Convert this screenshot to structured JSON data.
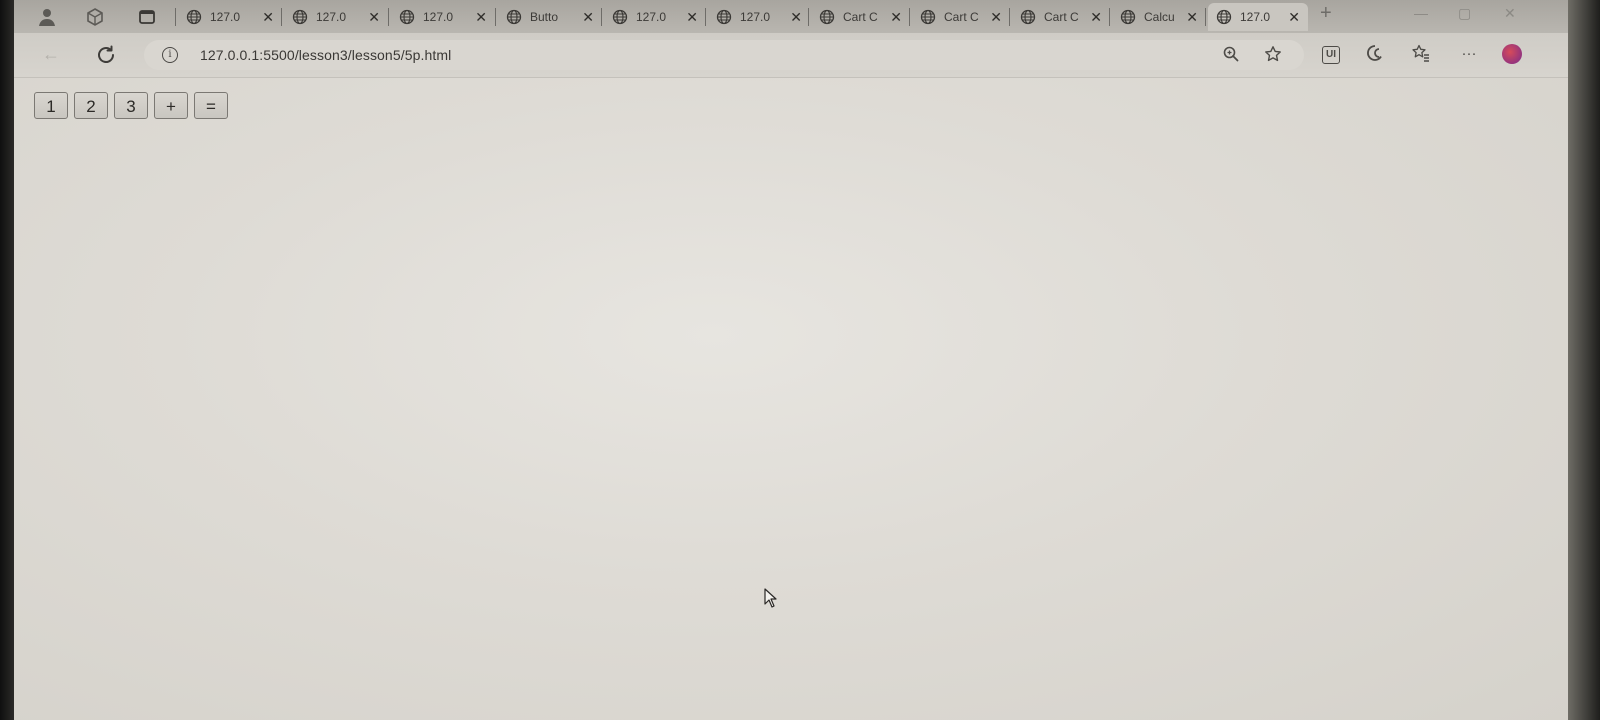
{
  "tabs": [
    {
      "title": "127.0",
      "active": false
    },
    {
      "title": "127.0",
      "active": false
    },
    {
      "title": "127.0",
      "active": false
    },
    {
      "title": "Butto",
      "active": false
    },
    {
      "title": "127.0",
      "active": false
    },
    {
      "title": "127.0",
      "active": false
    },
    {
      "title": "Cart C",
      "active": false
    },
    {
      "title": "Cart C",
      "active": false
    },
    {
      "title": "Cart C",
      "active": false
    },
    {
      "title": "Calcu",
      "active": false
    },
    {
      "title": "127.0",
      "active": true
    }
  ],
  "tab_close_glyph": "✕",
  "toolbar": {
    "url": "127.0.0.1:5500/lesson3/lesson5/5p.html",
    "ui_badge": "UI"
  },
  "calculator": {
    "buttons": [
      "1",
      "2",
      "3",
      "+",
      "="
    ]
  },
  "icons": {
    "tab": "globe-icon",
    "reload": "reload-icon",
    "info": "info-icon",
    "zoom": "zoom-icon",
    "favorite": "star-icon"
  }
}
